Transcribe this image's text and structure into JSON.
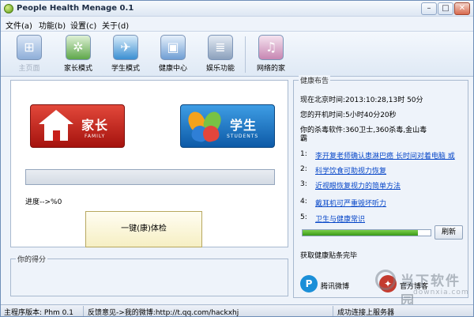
{
  "window": {
    "title": "People Health Menage 0.1",
    "minimize": "–",
    "maximize": "□",
    "close": "✕"
  },
  "menu": {
    "items": [
      "文件(a)",
      "功能(b)",
      "设置(c)",
      "关于(d)"
    ]
  },
  "toolbar": {
    "items": [
      {
        "label": "主页面",
        "icon": "windows-icon",
        "disabled": true
      },
      {
        "label": "家长模式",
        "icon": "network-icon"
      },
      {
        "label": "学生模式",
        "icon": "compass-icon"
      },
      {
        "label": "健康中心",
        "icon": "monitor-icon"
      },
      {
        "label": "娱乐功能",
        "icon": "server-icon"
      },
      {
        "label": "网络的家",
        "icon": "music-icon"
      }
    ]
  },
  "main": {
    "family_button": {
      "zh": "家长",
      "en": "FAMILY"
    },
    "student_button": {
      "zh": "学生",
      "en": "STUDENTS"
    },
    "progress_text": "进度-->%0",
    "progress_value": 0,
    "check_button": "一键(康)体检",
    "score_group_title": "你的得分"
  },
  "panel": {
    "title": "健康布告",
    "time_line": "现在北京时间:2013:10:28,13时 50分",
    "uptime_line": "您的开机时间:5小时40分20秒",
    "antivirus_line": "你的杀毒软件:360卫士,360杀毒,金山毒霸",
    "news": [
      {
        "num": "1:",
        "text": "李开复老师确认患淋巴癌 长时间对着电脑 或"
      },
      {
        "num": "2:",
        "text": "科学饮食可助视力恢复"
      },
      {
        "num": "3:",
        "text": "近视眼恢复视力的简单方法"
      },
      {
        "num": "4:",
        "text": "戴耳机可严重毁坏听力"
      },
      {
        "num": "5:",
        "text": "卫生与健康常识"
      }
    ],
    "fetch_progress": 0.9,
    "refresh_button": "刷新",
    "status_text": "获取健康贴条完毕",
    "share_weibo": "腾讯微博",
    "share_blog": "官方博客"
  },
  "statusbar": {
    "version": "主程序版本: Phm 0.1",
    "feedback": "反馈意见->我的微博:http://t.qq.com/hackxhj",
    "connection": "成功连接上服务器"
  },
  "watermark": {
    "cn": "当下软件园",
    "en": "downxia.com"
  },
  "colors": {
    "accent": "#0646c8",
    "family": "#c8201a",
    "student": "#1471c4",
    "progress": "#3d9b1c"
  }
}
